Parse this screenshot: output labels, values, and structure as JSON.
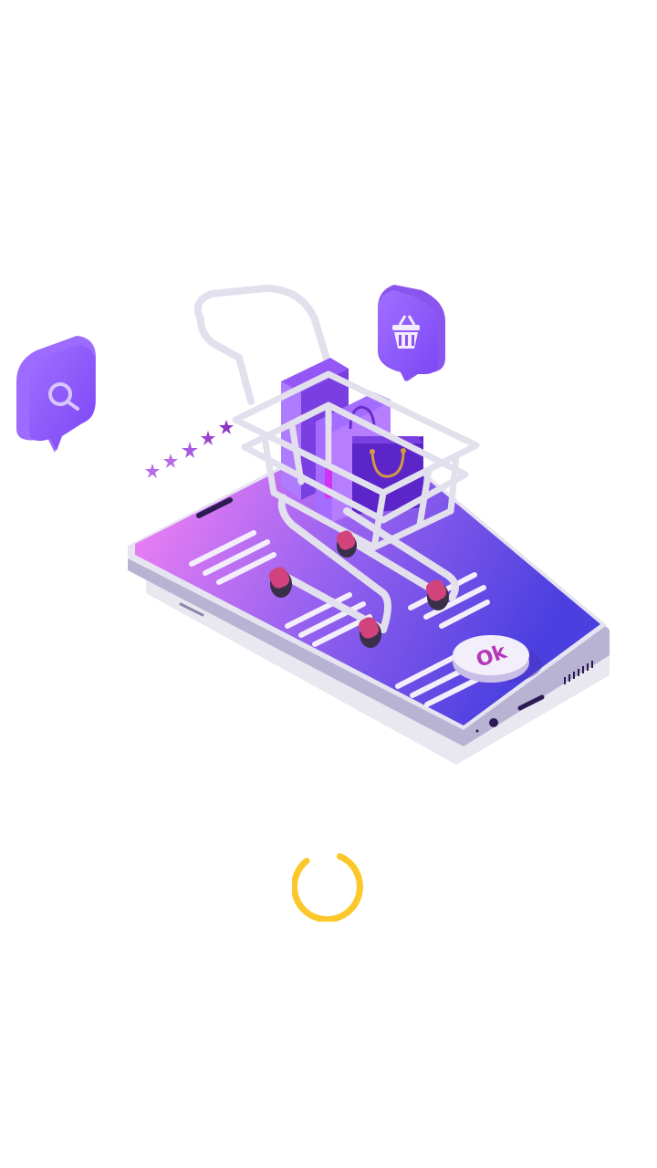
{
  "splash": {
    "ok_label": "Ok",
    "rating_stars": 5,
    "colors": {
      "phone_gradient_start": "#ff86f4",
      "phone_gradient_end": "#4b3fe0",
      "bubble_purple": "#8a4dff",
      "bag_purple": "#7a3fe0",
      "cart_frame": "#e3e0ee",
      "wheel_pink": "#d2437d",
      "spinner_color": "#fcc72a"
    },
    "icons": {
      "search_bubble": "search-icon",
      "basket_bubble": "basket-icon",
      "shopping_cart": "shopping-cart-icon",
      "loading": "loading-spinner-icon"
    }
  }
}
